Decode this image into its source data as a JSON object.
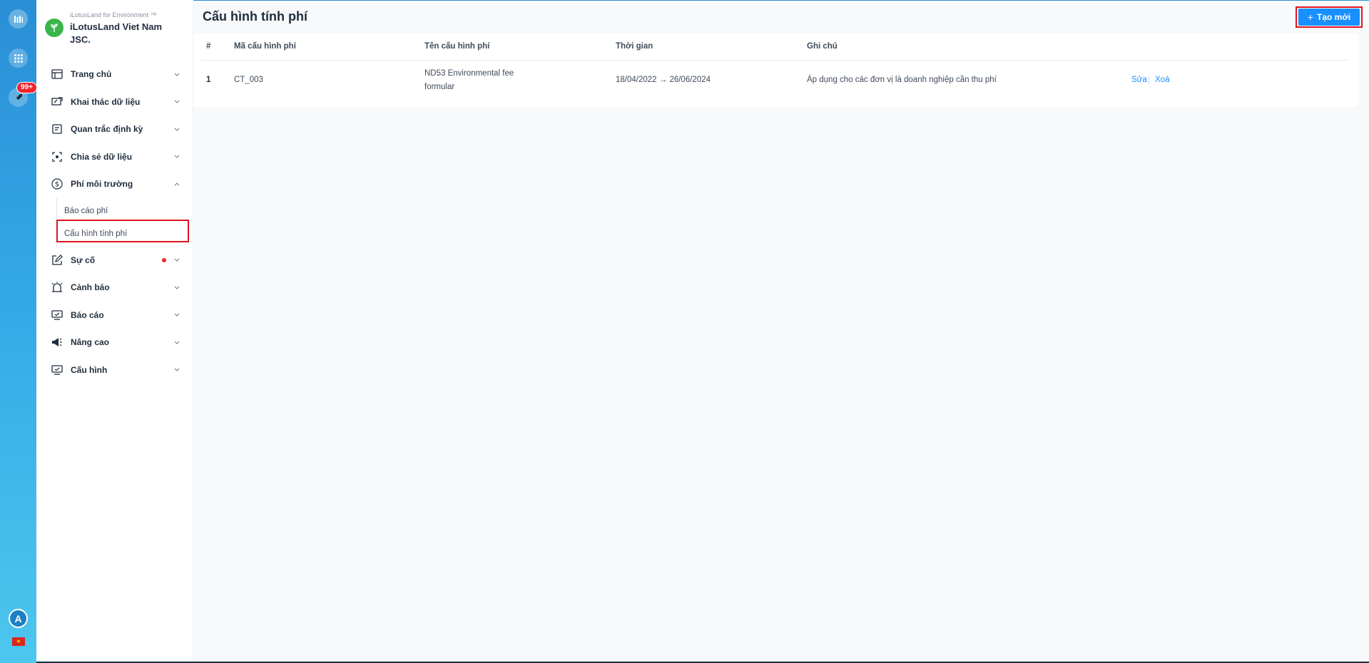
{
  "rail": {
    "badge": "99+",
    "avatar_initial": "A",
    "icons": [
      "logo-icon",
      "apps-grid-icon",
      "rocket-icon",
      "avatar",
      "vietnam-flag-icon"
    ]
  },
  "brand": {
    "subtitle": "iLotusLand for Environment ™",
    "name": "iLotusLand Viet Nam JSC."
  },
  "menu": [
    {
      "label": "Trang chủ",
      "icon": "layout-icon",
      "state": "collapsed"
    },
    {
      "label": "Khai thác dữ liệu",
      "icon": "monitor-data-icon",
      "state": "collapsed"
    },
    {
      "label": "Quan trắc định kỳ",
      "icon": "document-list-icon",
      "state": "collapsed"
    },
    {
      "label": "Chia sẻ dữ liệu",
      "icon": "share-focus-icon",
      "state": "collapsed"
    },
    {
      "label": "Phí môi trường",
      "icon": "dollar-circle-icon",
      "state": "expanded",
      "children": [
        {
          "label": "Báo cáo phí",
          "active": false
        },
        {
          "label": "Cấu hình tính phí",
          "active": true
        }
      ]
    },
    {
      "label": "Sự cố",
      "icon": "edit-icon",
      "state": "collapsed",
      "has_dot": true
    },
    {
      "label": "Cảnh báo",
      "icon": "alarm-icon",
      "state": "collapsed"
    },
    {
      "label": "Báo cáo",
      "icon": "report-icon",
      "state": "collapsed"
    },
    {
      "label": "Nâng cao",
      "icon": "megaphone-icon",
      "state": "collapsed"
    },
    {
      "label": "Cấu hình",
      "icon": "config-icon",
      "state": "collapsed"
    }
  ],
  "page": {
    "title": "Cấu hình tính phí",
    "new_button": "Tạo mới"
  },
  "table": {
    "columns": [
      "#",
      "Mã cấu hình phí",
      "Tên cấu hình phí",
      "Thời gian",
      "Ghi chú"
    ],
    "rows": [
      {
        "index": "1",
        "code": "CT_003",
        "name": "ND53 Environmental fee formular",
        "time": "18/04/2022 → 26/06/2024",
        "note": "Áp dụng cho các đơn vị là doanh nghiệp cần thu phí",
        "edit": "Sửa",
        "delete": "Xoá"
      }
    ]
  },
  "colors": {
    "accent": "#1890ff",
    "rail_top": "#2a8fd6",
    "rail_bottom": "#4cc7ee",
    "highlight": "#e0141e",
    "badge": "#f5222d"
  }
}
